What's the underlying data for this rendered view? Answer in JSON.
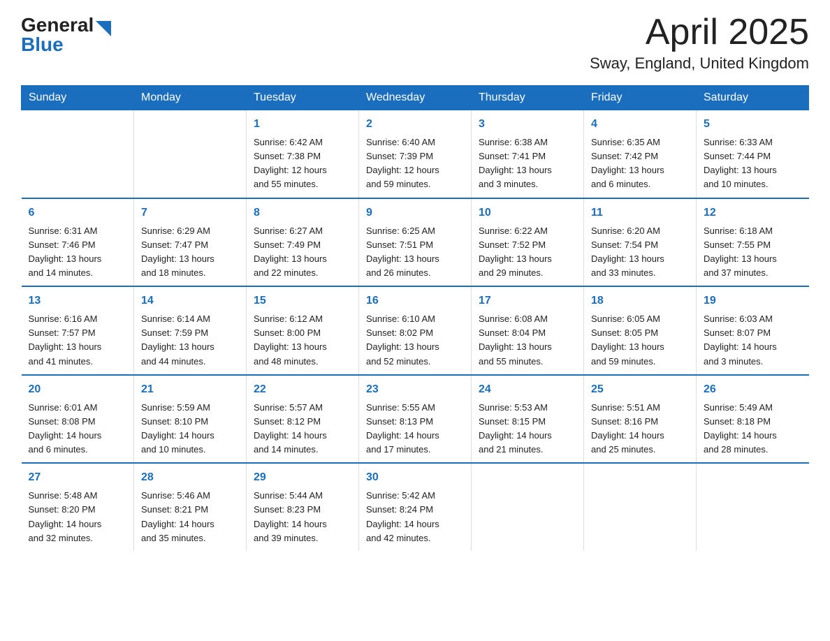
{
  "logo": {
    "general": "General",
    "blue": "Blue",
    "arrow_color": "#1a6ebd"
  },
  "title": "April 2025",
  "subtitle": "Sway, England, United Kingdom",
  "headers": [
    "Sunday",
    "Monday",
    "Tuesday",
    "Wednesday",
    "Thursday",
    "Friday",
    "Saturday"
  ],
  "weeks": [
    [
      {
        "day": "",
        "info": ""
      },
      {
        "day": "",
        "info": ""
      },
      {
        "day": "1",
        "info": "Sunrise: 6:42 AM\nSunset: 7:38 PM\nDaylight: 12 hours\nand 55 minutes."
      },
      {
        "day": "2",
        "info": "Sunrise: 6:40 AM\nSunset: 7:39 PM\nDaylight: 12 hours\nand 59 minutes."
      },
      {
        "day": "3",
        "info": "Sunrise: 6:38 AM\nSunset: 7:41 PM\nDaylight: 13 hours\nand 3 minutes."
      },
      {
        "day": "4",
        "info": "Sunrise: 6:35 AM\nSunset: 7:42 PM\nDaylight: 13 hours\nand 6 minutes."
      },
      {
        "day": "5",
        "info": "Sunrise: 6:33 AM\nSunset: 7:44 PM\nDaylight: 13 hours\nand 10 minutes."
      }
    ],
    [
      {
        "day": "6",
        "info": "Sunrise: 6:31 AM\nSunset: 7:46 PM\nDaylight: 13 hours\nand 14 minutes."
      },
      {
        "day": "7",
        "info": "Sunrise: 6:29 AM\nSunset: 7:47 PM\nDaylight: 13 hours\nand 18 minutes."
      },
      {
        "day": "8",
        "info": "Sunrise: 6:27 AM\nSunset: 7:49 PM\nDaylight: 13 hours\nand 22 minutes."
      },
      {
        "day": "9",
        "info": "Sunrise: 6:25 AM\nSunset: 7:51 PM\nDaylight: 13 hours\nand 26 minutes."
      },
      {
        "day": "10",
        "info": "Sunrise: 6:22 AM\nSunset: 7:52 PM\nDaylight: 13 hours\nand 29 minutes."
      },
      {
        "day": "11",
        "info": "Sunrise: 6:20 AM\nSunset: 7:54 PM\nDaylight: 13 hours\nand 33 minutes."
      },
      {
        "day": "12",
        "info": "Sunrise: 6:18 AM\nSunset: 7:55 PM\nDaylight: 13 hours\nand 37 minutes."
      }
    ],
    [
      {
        "day": "13",
        "info": "Sunrise: 6:16 AM\nSunset: 7:57 PM\nDaylight: 13 hours\nand 41 minutes."
      },
      {
        "day": "14",
        "info": "Sunrise: 6:14 AM\nSunset: 7:59 PM\nDaylight: 13 hours\nand 44 minutes."
      },
      {
        "day": "15",
        "info": "Sunrise: 6:12 AM\nSunset: 8:00 PM\nDaylight: 13 hours\nand 48 minutes."
      },
      {
        "day": "16",
        "info": "Sunrise: 6:10 AM\nSunset: 8:02 PM\nDaylight: 13 hours\nand 52 minutes."
      },
      {
        "day": "17",
        "info": "Sunrise: 6:08 AM\nSunset: 8:04 PM\nDaylight: 13 hours\nand 55 minutes."
      },
      {
        "day": "18",
        "info": "Sunrise: 6:05 AM\nSunset: 8:05 PM\nDaylight: 13 hours\nand 59 minutes."
      },
      {
        "day": "19",
        "info": "Sunrise: 6:03 AM\nSunset: 8:07 PM\nDaylight: 14 hours\nand 3 minutes."
      }
    ],
    [
      {
        "day": "20",
        "info": "Sunrise: 6:01 AM\nSunset: 8:08 PM\nDaylight: 14 hours\nand 6 minutes."
      },
      {
        "day": "21",
        "info": "Sunrise: 5:59 AM\nSunset: 8:10 PM\nDaylight: 14 hours\nand 10 minutes."
      },
      {
        "day": "22",
        "info": "Sunrise: 5:57 AM\nSunset: 8:12 PM\nDaylight: 14 hours\nand 14 minutes."
      },
      {
        "day": "23",
        "info": "Sunrise: 5:55 AM\nSunset: 8:13 PM\nDaylight: 14 hours\nand 17 minutes."
      },
      {
        "day": "24",
        "info": "Sunrise: 5:53 AM\nSunset: 8:15 PM\nDaylight: 14 hours\nand 21 minutes."
      },
      {
        "day": "25",
        "info": "Sunrise: 5:51 AM\nSunset: 8:16 PM\nDaylight: 14 hours\nand 25 minutes."
      },
      {
        "day": "26",
        "info": "Sunrise: 5:49 AM\nSunset: 8:18 PM\nDaylight: 14 hours\nand 28 minutes."
      }
    ],
    [
      {
        "day": "27",
        "info": "Sunrise: 5:48 AM\nSunset: 8:20 PM\nDaylight: 14 hours\nand 32 minutes."
      },
      {
        "day": "28",
        "info": "Sunrise: 5:46 AM\nSunset: 8:21 PM\nDaylight: 14 hours\nand 35 minutes."
      },
      {
        "day": "29",
        "info": "Sunrise: 5:44 AM\nSunset: 8:23 PM\nDaylight: 14 hours\nand 39 minutes."
      },
      {
        "day": "30",
        "info": "Sunrise: 5:42 AM\nSunset: 8:24 PM\nDaylight: 14 hours\nand 42 minutes."
      },
      {
        "day": "",
        "info": ""
      },
      {
        "day": "",
        "info": ""
      },
      {
        "day": "",
        "info": ""
      }
    ]
  ]
}
